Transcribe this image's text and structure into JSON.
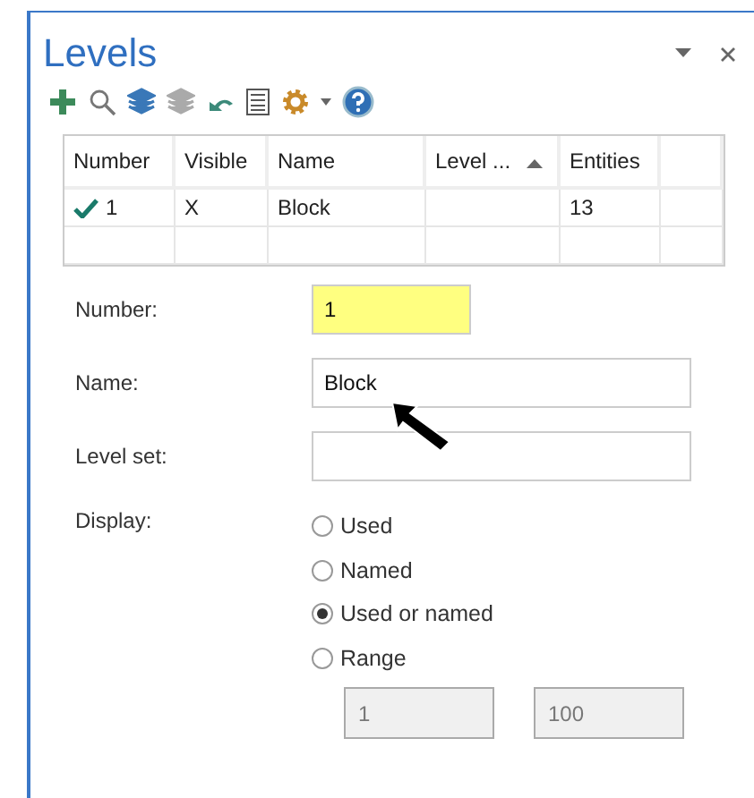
{
  "panel": {
    "title": "Levels"
  },
  "table": {
    "columns": [
      {
        "label": "Number",
        "sorted": false
      },
      {
        "label": "Visible",
        "sorted": false
      },
      {
        "label": "Name",
        "sorted": false
      },
      {
        "label": "Level ...",
        "sorted": true
      },
      {
        "label": "Entities",
        "sorted": false
      }
    ],
    "rows": [
      {
        "current": true,
        "cells": [
          "1",
          "X",
          "Block",
          "",
          "13"
        ]
      }
    ]
  },
  "fields": [
    {
      "label": "Number:",
      "value": "1",
      "highlighted": true
    },
    {
      "label": "Name:",
      "value": "Block",
      "highlighted": false
    },
    {
      "label": "Level set:",
      "highlighted": false
    }
  ],
  "display": {
    "label": "Display:",
    "options": [
      {
        "label": "Used",
        "selected": false
      },
      {
        "label": "Named",
        "selected": false
      },
      {
        "label": "Used or named",
        "selected": true
      },
      {
        "label": "Range",
        "selected": false
      }
    ],
    "range": [
      {
        "value": "1",
        "disabled": true
      },
      {
        "value": "100",
        "disabled": true
      }
    ]
  }
}
